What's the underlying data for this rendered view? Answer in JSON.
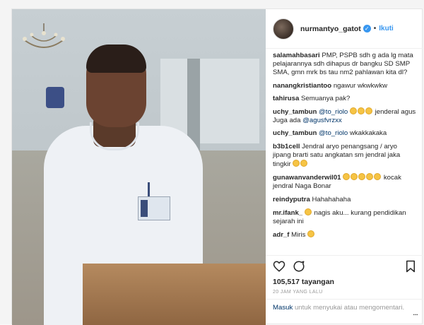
{
  "header": {
    "username": "nurmantyo_gatot",
    "verified_icon": "verified-badge-icon",
    "separator": "•",
    "follow_label": "Ikuti"
  },
  "comments": [
    {
      "user": "salamahbasari",
      "text": "PMP, PSPB sdh g ada lg mata pelajarannya sdh dihapus dr bangku SD SMP SMA, gmn mrk bs tau nm2 pahlawan kita dl?"
    },
    {
      "user": "nanangkristiantoo",
      "text": "ngawur wkwkwkw"
    },
    {
      "user": "tahirusa",
      "text": "Semuanya pak?"
    },
    {
      "user": "uchy_tambun",
      "mention1": "@to_riolo",
      "text_mid": "jenderal agus Juga ada",
      "mention2": "@agusfvrzxx"
    },
    {
      "user": "uchy_tambun",
      "mention1": "@to_riolo",
      "text": "wkakkakaka"
    },
    {
      "user": "b3b1cell",
      "text": "Jendral aryo penangsang / aryo jipang brarti satu angkatan sm jendral jaka tingkir"
    },
    {
      "user": "gunawanvanderwil01",
      "text": "kocak jendral Naga Bonar"
    },
    {
      "user": "reindyputra",
      "text": "Hahahahaha"
    },
    {
      "user": "mr.ifank_",
      "text": "nagis aku... kurang pendidikan sejarah ini"
    },
    {
      "user": "adr_f",
      "text": "Miris"
    }
  ],
  "stats": {
    "views": "105,517 tayangan",
    "time": "20 JAM YANG LALU"
  },
  "login": {
    "link": "Masuk",
    "text": "untuk menyukai atau mengomentari.",
    "options": "..."
  },
  "icons": {
    "like": "heart-icon",
    "comment": "comment-icon",
    "save": "bookmark-icon"
  },
  "colors": {
    "link": "#003569",
    "accent": "#3897f0",
    "muted": "#999999"
  }
}
